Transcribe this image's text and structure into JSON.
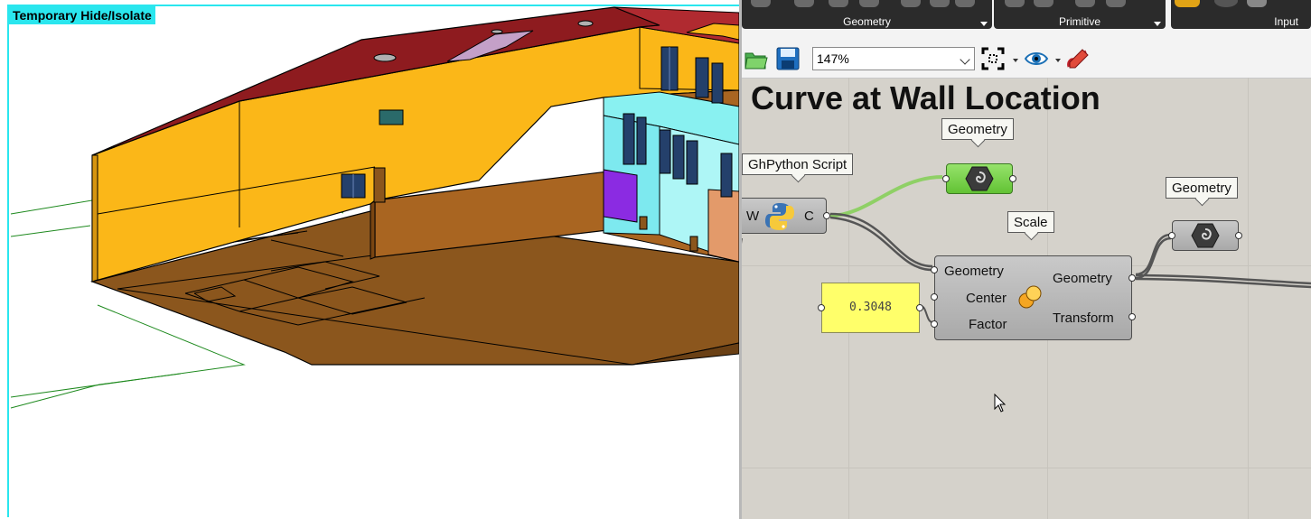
{
  "viewport": {
    "mode_banner": "Temporary Hide/Isolate"
  },
  "ribbon": {
    "groups": [
      {
        "label": "Geometry"
      },
      {
        "label": "Primitive"
      },
      {
        "label": "Input"
      }
    ]
  },
  "toolbar": {
    "open_icon": "open-folder-icon",
    "save_icon": "save-disk-icon",
    "zoom_value": "147%",
    "zoom_extents_icon": "zoom-extents-icon",
    "preview_icon": "eye-icon",
    "sketch_icon": "pen-icon"
  },
  "canvas": {
    "title": "Curve at Wall Location",
    "bubbles": {
      "python": "GhPython Script",
      "geometry_top": "Geometry",
      "scale": "Scale",
      "geometry_right": "Geometry"
    },
    "python": {
      "input": "W",
      "output": "C"
    },
    "scale": {
      "inputs": [
        "Geometry",
        "Center",
        "Factor"
      ],
      "outputs": [
        "Geometry",
        "Transform"
      ]
    },
    "slider_value": "0.3048"
  },
  "colors": {
    "wall_yellow": "#fbb718",
    "floor_brown": "#8b561d",
    "roof_red": "#8e1b1f",
    "isolate_cyan": "#2ae6ee",
    "selected_green": "#7bd54b",
    "slider_yellow": "#ffff6a"
  }
}
